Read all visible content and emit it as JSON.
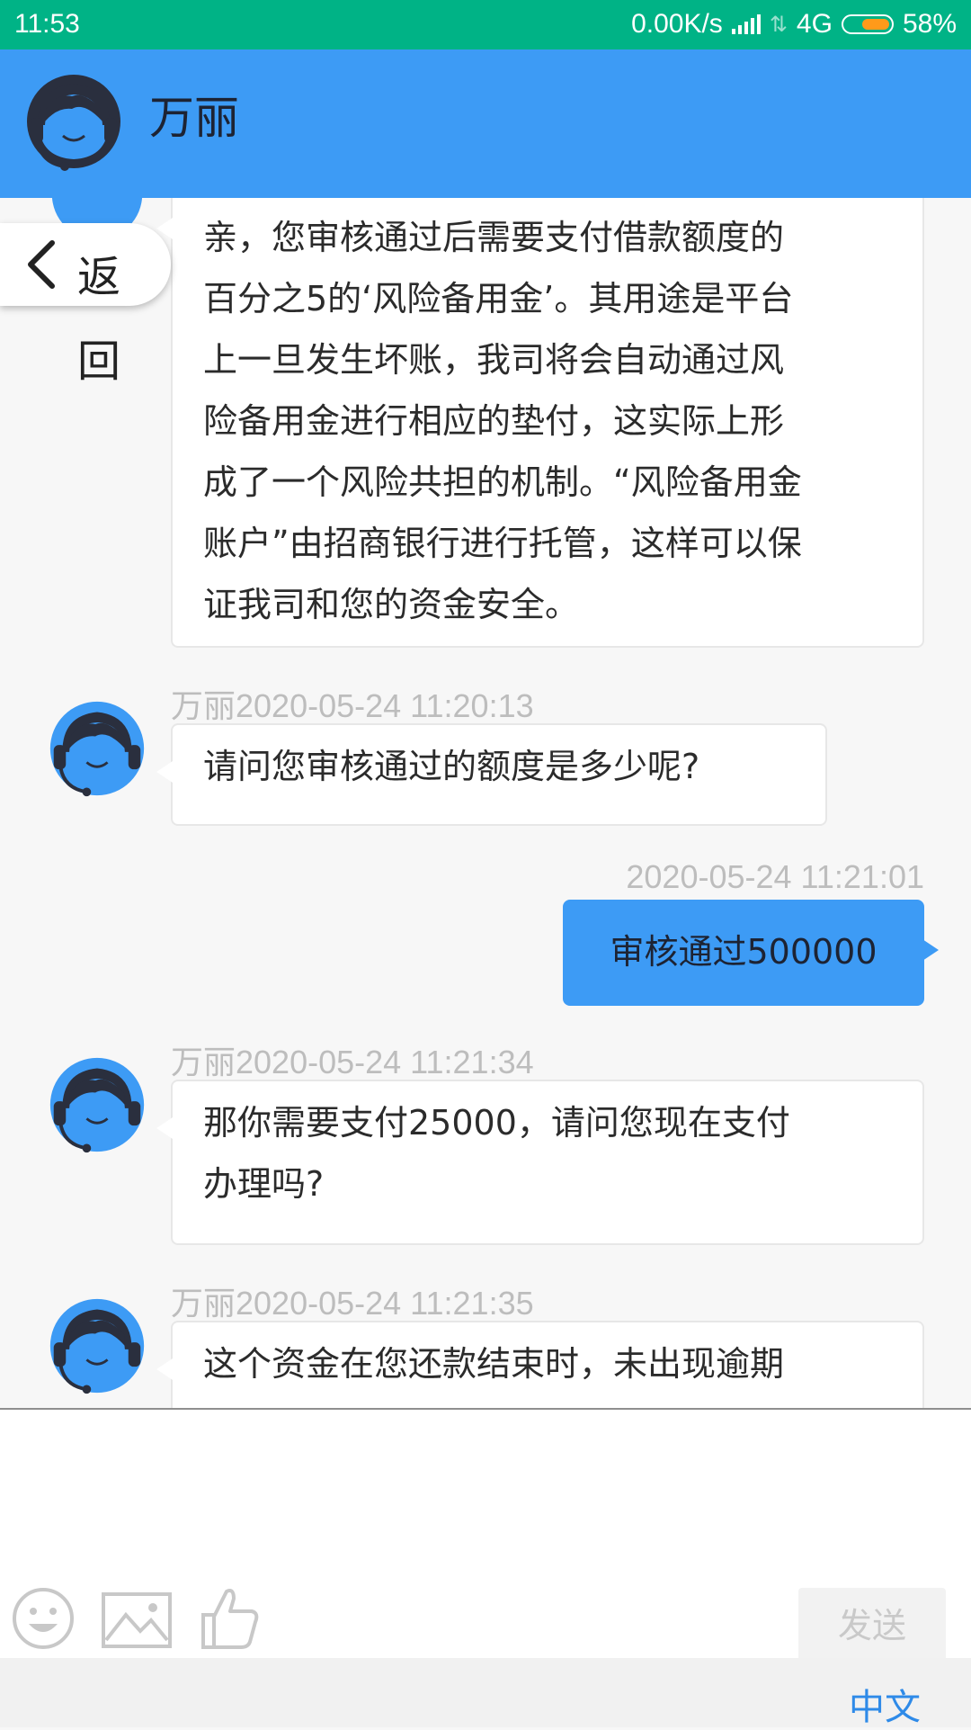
{
  "status_bar": {
    "time": "11:53",
    "network_speed": "0.00K/s",
    "network_type": "4G",
    "battery": "58%",
    "battery_level_percent": 58,
    "color": "#00b386"
  },
  "header": {
    "contact_name": "万丽",
    "color": "#3d9bf5",
    "avatar_icon": "customer-service-agent-icon"
  },
  "back_button": {
    "label_line1": "返",
    "label_line2": "回",
    "icon": "chevron-left-icon"
  },
  "messages": [
    {
      "side": "left",
      "lines": [
        "亲，您审核通过后需要支付借款额度的",
        "百分之5的‘风险备用金’。其用途是平台",
        "上一旦发生坏账，我司将会自动通过风",
        "险备用金进行相应的垫付，这实际上形",
        "成了一个风险共担的机制。“风险备用金",
        "账户”由招商银行进行托管，这样可以保",
        "证我司和您的资金安全。"
      ]
    },
    {
      "side": "left",
      "meta": "万丽2020-05-24 11:20:13",
      "lines": [
        "请问您审核通过的额度是多少呢?"
      ]
    },
    {
      "side": "right",
      "meta": "2020-05-24 11:21:01",
      "lines": [
        "审核通过500000"
      ]
    },
    {
      "side": "left",
      "meta": "万丽2020-05-24 11:21:34",
      "lines": [
        "那你需要支付25000，请问您现在支付",
        "办理吗?"
      ]
    },
    {
      "side": "left",
      "meta": "万丽2020-05-24 11:21:35",
      "lines": [
        "这个资金在您还款结束时，未出现逾期"
      ]
    }
  ],
  "input": {
    "value": "",
    "send_label": "发送",
    "tools": [
      "emoji-icon",
      "image-icon",
      "thumbs-up-icon"
    ]
  },
  "bottom_bar": {
    "language_toggle": "中文",
    "accent": "#2e8ae8"
  }
}
